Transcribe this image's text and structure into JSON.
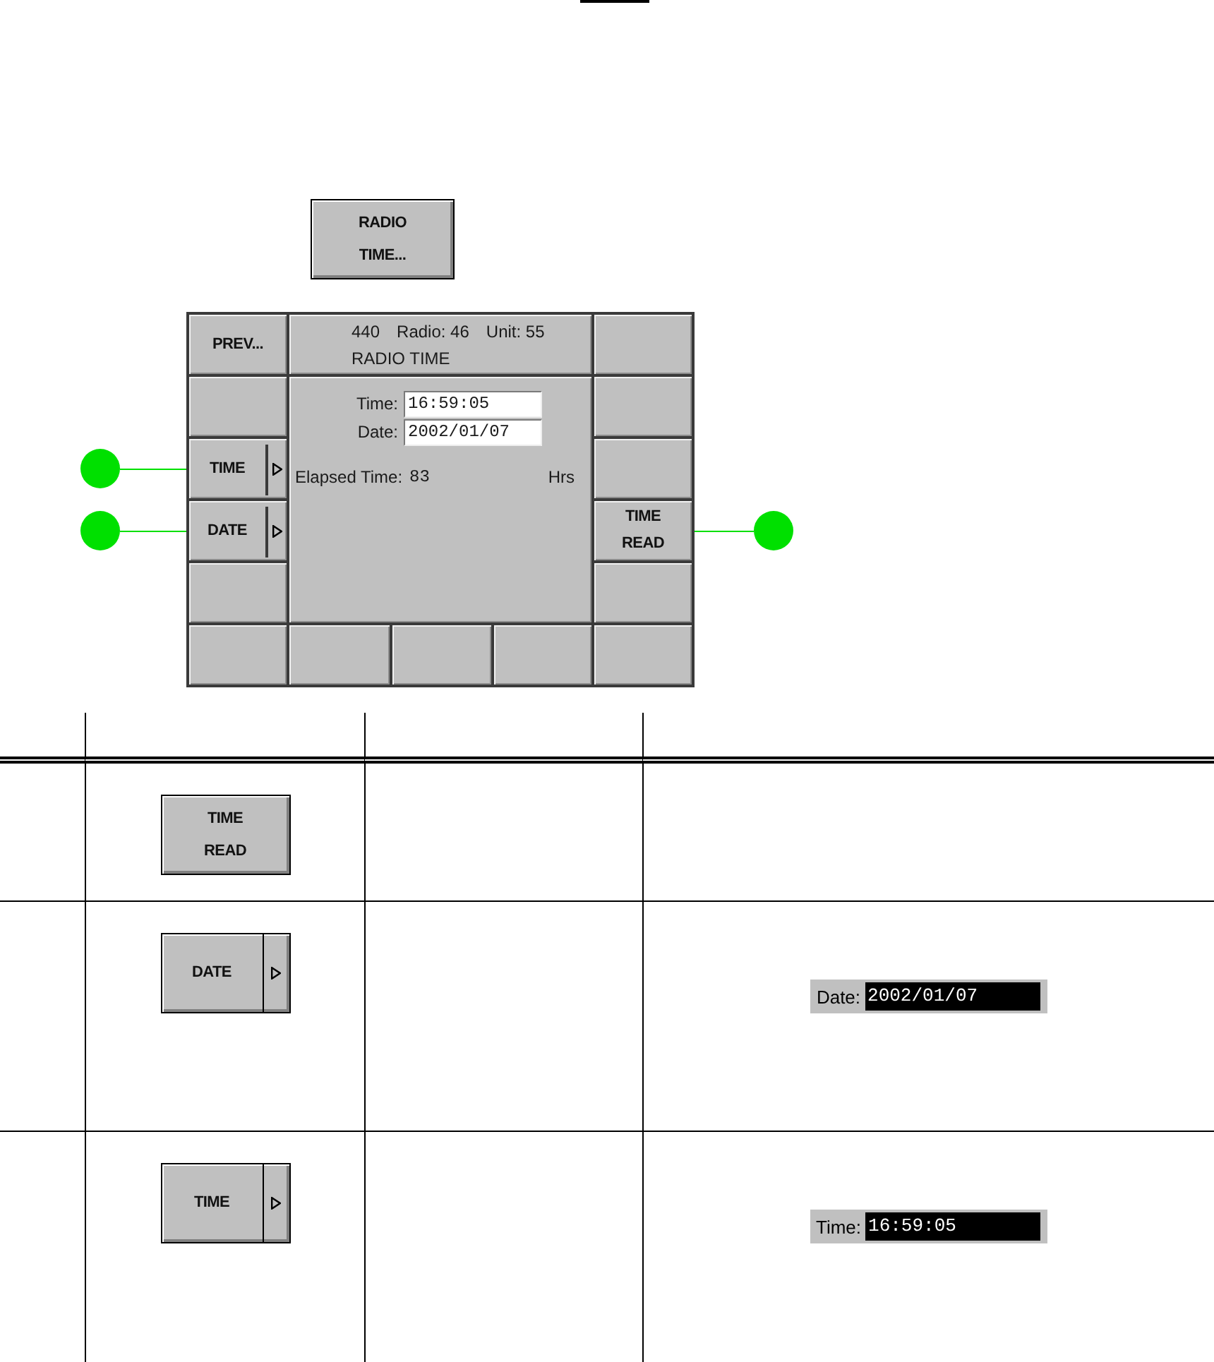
{
  "radio_time_button": {
    "kind": "action",
    "lines": [
      "RADIO",
      "TIME..."
    ]
  },
  "screen": {
    "header": {
      "items": [
        "440",
        "Radio: 46",
        "Unit: 55"
      ],
      "title": "RADIO TIME"
    },
    "left_keys": [
      {
        "kind": "action",
        "lines": [
          "PREV..."
        ],
        "callout": false
      },
      {
        "kind": "blank",
        "callout": false
      },
      {
        "kind": "submenu",
        "lines": [
          "TIME"
        ],
        "callout": true
      },
      {
        "kind": "submenu",
        "lines": [
          "DATE"
        ],
        "callout": true
      },
      {
        "kind": "blank",
        "callout": false
      }
    ],
    "right_keys": [
      {
        "kind": "blank",
        "callout": false
      },
      {
        "kind": "blank",
        "callout": false
      },
      {
        "kind": "blank",
        "callout": false
      },
      {
        "kind": "action",
        "lines": [
          "TIME",
          "READ"
        ],
        "callout": true
      },
      {
        "kind": "blank",
        "callout": false
      }
    ],
    "bottom_keys": [
      {
        "kind": "blank"
      },
      {
        "kind": "blank"
      },
      {
        "kind": "blank"
      },
      {
        "kind": "blank"
      },
      {
        "kind": "blank"
      }
    ],
    "body": {
      "fields": [
        {
          "label": "Time:",
          "value": "16:59:05",
          "selected": false
        },
        {
          "label": "Date:",
          "value": "2002/01/07",
          "selected": false
        }
      ],
      "elapsed": {
        "label": "Elapsed Time:",
        "value": "83",
        "unit": "Hrs"
      }
    }
  },
  "table": {
    "rows": [
      {
        "key": {
          "kind": "action",
          "lines": [
            "TIME",
            "READ"
          ]
        }
      },
      {
        "key": {
          "kind": "submenu",
          "lines": [
            "DATE"
          ]
        },
        "field": {
          "label": "Date:",
          "value": "2002/01/07",
          "selected": true
        }
      },
      {
        "key": {
          "kind": "submenu",
          "lines": [
            "TIME"
          ]
        },
        "field": {
          "label": "Time:",
          "value": "16:59:05",
          "selected": true
        }
      }
    ]
  }
}
